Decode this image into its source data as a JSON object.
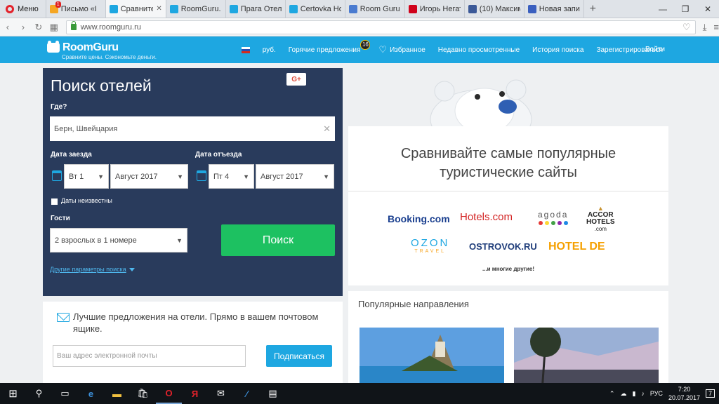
{
  "browser": {
    "menu_label": "Меню",
    "tabs": [
      {
        "title": "Письмо «I",
        "icon": "mail-icon",
        "badge": "1",
        "color": "#f5a623"
      },
      {
        "title": "Сравните о",
        "icon": "roomguru-icon",
        "color": "#1ea7e1",
        "active": true
      },
      {
        "title": "RoomGuru.",
        "icon": "roomguru-icon",
        "color": "#1ea7e1"
      },
      {
        "title": "Прага Отел",
        "icon": "roomguru-icon",
        "color": "#1ea7e1"
      },
      {
        "title": "Certovka Ho",
        "icon": "roomguru-icon",
        "color": "#1ea7e1"
      },
      {
        "title": "Room Guru",
        "icon": "doc-icon",
        "color": "#4a7bd0"
      },
      {
        "title": "Игорь Негат",
        "icon": "chart-icon",
        "color": "#d0021b"
      },
      {
        "title": "(10) Максим",
        "icon": "facebook-icon",
        "color": "#3b5998"
      },
      {
        "title": "Новая запи",
        "icon": "bird-icon",
        "color": "#3a5fbf"
      }
    ],
    "new_tab": "+",
    "url": "www.roomguru.ru"
  },
  "header": {
    "logo": "RoomGuru",
    "tagline": "Сравните цены. Сэкономьте деньги.",
    "currency": "руб.",
    "hot_deals": "Горячие предложения",
    "hot_count": "16",
    "favorites": "Избранное",
    "recent": "Недавно просмотренные",
    "history": "История поиска",
    "register": "Зарегистрироваться",
    "login": "Войти"
  },
  "search": {
    "title": "Поиск отелей",
    "gplus": "G+",
    "where_label": "Где?",
    "where_value": "Берн, Швейцария",
    "checkin_label": "Дата заезда",
    "checkin_day": "Вт 1",
    "checkin_month": "Август 2017",
    "checkout_label": "Дата отъезда",
    "checkout_day": "Пт 4",
    "checkout_month": "Август 2017",
    "dates_unknown": "Даты неизвестны",
    "guests_label": "Гости",
    "guests_value": "2 взрослых в 1 номере",
    "search_button": "Поиск",
    "more_params": "Другие параметры поиска"
  },
  "email": {
    "text": "Лучшие предложения на отели. Прямо в вашем почтовом ящике.",
    "placeholder": "Ваш адрес электронной почты",
    "subscribe": "Подписаться"
  },
  "compare": {
    "title_line1": "Сравнивайте самые популярные",
    "title_line2": "туристические сайты",
    "brands": {
      "booking": "Booking.com",
      "hotels": "Hotels.com",
      "agoda": "agoda",
      "accor1": "ACCOR",
      "accor2": "HOTELS",
      "accor3": ".com",
      "ozon": "OZON",
      "ozon_sub": "TRAVEL",
      "ostrovok": "OSTROVOK.RU",
      "hotelde": "HOTEL DE"
    },
    "more": "...и многие другие!"
  },
  "popular": {
    "title": "Популярные направления"
  },
  "taskbar": {
    "lang": "РУС",
    "time": "7:20",
    "date": "20.07.2017",
    "notif": "7"
  },
  "colors": {
    "brand_blue": "#1ea7e1",
    "panel_navy": "#293b5c",
    "search_green": "#1dc161"
  }
}
